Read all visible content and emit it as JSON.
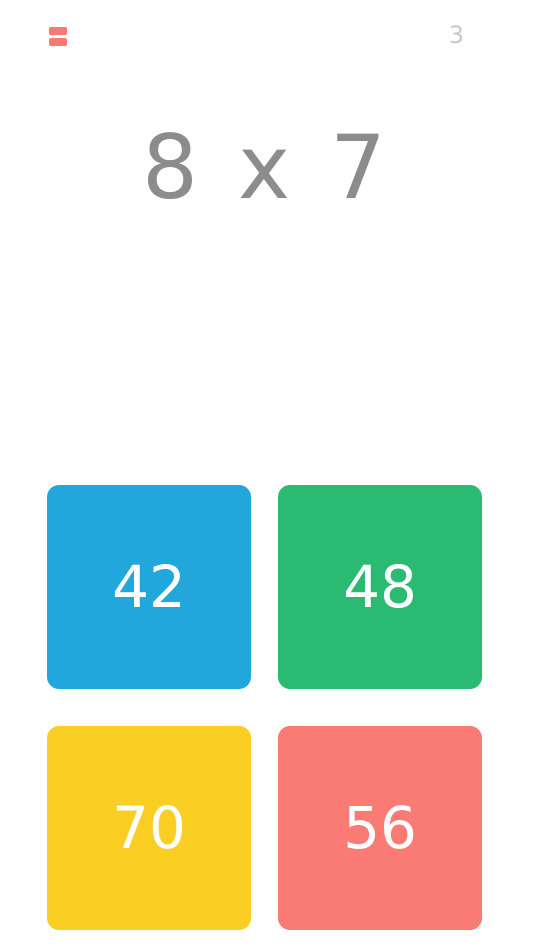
{
  "header": {
    "menu_icon": "menu-icon",
    "menu_color": "#f87a74",
    "score": "3"
  },
  "question": {
    "text": "8 x 7"
  },
  "answers": [
    {
      "label": "42",
      "color": "#22a7dc"
    },
    {
      "label": "48",
      "color": "#2bba72"
    },
    {
      "label": "70",
      "color": "#fbce24"
    },
    {
      "label": "56",
      "color": "#fa7a74"
    }
  ]
}
